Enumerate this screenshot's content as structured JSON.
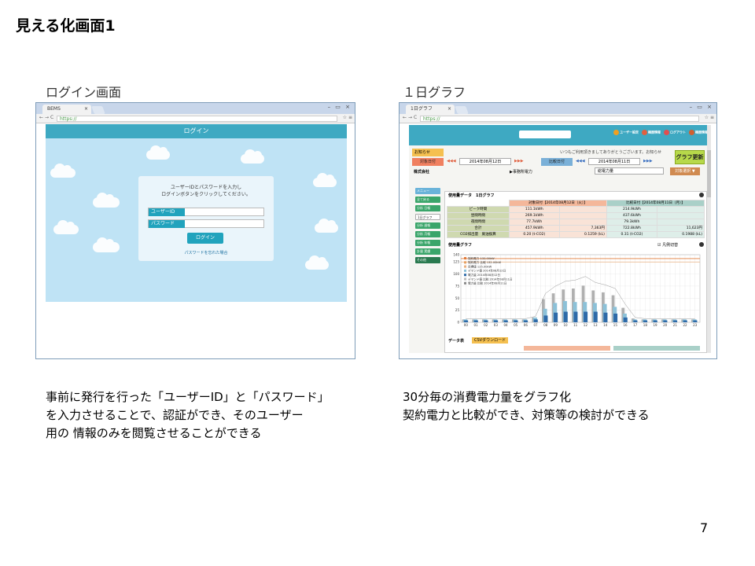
{
  "slide": {
    "title": "見える化画面1",
    "page_number": "7"
  },
  "left": {
    "caption": "ログイン画面",
    "description": [
      "事前に発行を行った「ユーザーID」と「パスワード」",
      "を入力させることで、認証ができ、そのユーザー",
      "用の 情報のみを閲覧させることができる"
    ],
    "browser": {
      "tab_label": "BEMS",
      "url": "https://"
    },
    "login": {
      "header": "ログイン",
      "message_line1": "ユーザーIDとパスワードを入力し",
      "message_line2": "ログインボタンをクリックしてください。",
      "user_id_label": "ユーザーID",
      "password_label": "パスワード",
      "login_button": "ログイン",
      "forgot_link": "パスワードを忘れた場合"
    }
  },
  "right": {
    "caption": "１日グラフ",
    "description": [
      "30分毎の消費電力量をグラフ化",
      "契約電力と比較ができ、対策等の検討ができる"
    ],
    "browser": {
      "tab_label": "1日グラフ",
      "url": "https://"
    },
    "app": {
      "nav_icons": [
        "ユーザー設定",
        "機器情報",
        "ログアウト",
        "機器情報"
      ],
      "notice_label": "お知らせ",
      "notice_text": "いつもご利用頂きましてありがとうございます。お知らせ",
      "graph_update_button": "グラフ更新",
      "target_date_label": "対象日付",
      "target_date": "2014年08月12日",
      "compare_date_label": "比較日付",
      "compare_date": "2014年08月11日",
      "company": "株式会社",
      "office_label": "▶事務所電力",
      "total_label": "総電力量",
      "select_button": "対象選択 ▼",
      "side_menu": [
        "メニュー",
        "全て戻る",
        "分析 日報",
        "1日グラフ",
        "分析 週報",
        "分析 月報",
        "分析 年報",
        "計量 実績",
        "その他"
      ],
      "panel_title": "使用量データ　1日グラフ",
      "table": {
        "head_a": "対象日付【2014年08月12日（火）】",
        "head_b": "比較日付【2014年08月11日（月）】",
        "rows": [
          {
            "label": "ピーク時間",
            "a1": "111.1kWh",
            "a2": "",
            "b1": "214.9kWh",
            "b2": ""
          },
          {
            "label": "昼間時間",
            "a1": "269.1kWh",
            "a2": "",
            "b1": "437.6kWh",
            "b2": ""
          },
          {
            "label": "夜間時間",
            "a1": "77.7kWh",
            "a2": "",
            "b1": "79.3kWh",
            "b2": ""
          },
          {
            "label": "合計",
            "a1": "457.9kWh",
            "a2": "7,363円",
            "b1": "722.8kWh",
            "b2": "11,623円"
          },
          {
            "label": "CO2排出量　廃油換算",
            "a1": "0.20 (t-CO2)",
            "a2": "0.1259 (kL)",
            "b1": "0.31 (t-CO2)",
            "b2": "0.1988 (kL)"
          }
        ]
      },
      "chart_section_title": "使用量グラフ",
      "chart_option": "☑ 凡例切替",
      "data_table_label": "データ表",
      "csv_button": "CSVダウンロード"
    }
  },
  "chart_data": {
    "type": "bar",
    "legend": [
      "契約電力 132.00kW",
      "契約電力 比較 132.00kW",
      "目標値 125.00kW",
      "デマンド値 2014年08月12日",
      "電力量 2014年08月12日",
      "デマンド値 比較 2014年08月11日",
      "電力量 比較 2014年08月11日"
    ],
    "yticks": [
      "0",
      "25",
      "50",
      "75",
      "100",
      "125",
      "140"
    ],
    "ylim": [
      0,
      140
    ],
    "categories": [
      "00",
      "01",
      "02",
      "03",
      "04",
      "05",
      "06",
      "07",
      "08",
      "09",
      "10",
      "11",
      "12",
      "13",
      "14",
      "15",
      "16",
      "17",
      "18",
      "19",
      "20",
      "21",
      "22",
      "23"
    ],
    "series": [
      {
        "name": "電力量 2014年08月12日",
        "color": "#2e6aa8",
        "values": [
          4,
          4,
          4,
          4,
          4,
          4,
          4,
          6,
          14,
          20,
          22,
          22,
          22,
          22,
          20,
          18,
          10,
          4,
          4,
          4,
          4,
          4,
          4,
          4
        ]
      },
      {
        "name": "デマンド値 2014年08月12日",
        "color": "#8cc1d8",
        "values": [
          6,
          6,
          6,
          6,
          6,
          6,
          6,
          10,
          28,
          40,
          44,
          42,
          42,
          40,
          38,
          32,
          18,
          6,
          6,
          6,
          6,
          6,
          6,
          6
        ]
      },
      {
        "name": "電力量 比較 2014年08月11日",
        "color": "#b0b0b0",
        "values": [
          6,
          6,
          6,
          6,
          6,
          6,
          6,
          10,
          48,
          60,
          68,
          70,
          76,
          66,
          62,
          56,
          30,
          8,
          6,
          6,
          6,
          6,
          6,
          6
        ]
      }
    ],
    "reference_lines": [
      {
        "name": "契約電力 132.00kW",
        "value": 132,
        "color": "#e07b3a"
      },
      {
        "name": "目標値 125.00kW",
        "value": 125,
        "color": "#e8b080"
      }
    ]
  }
}
